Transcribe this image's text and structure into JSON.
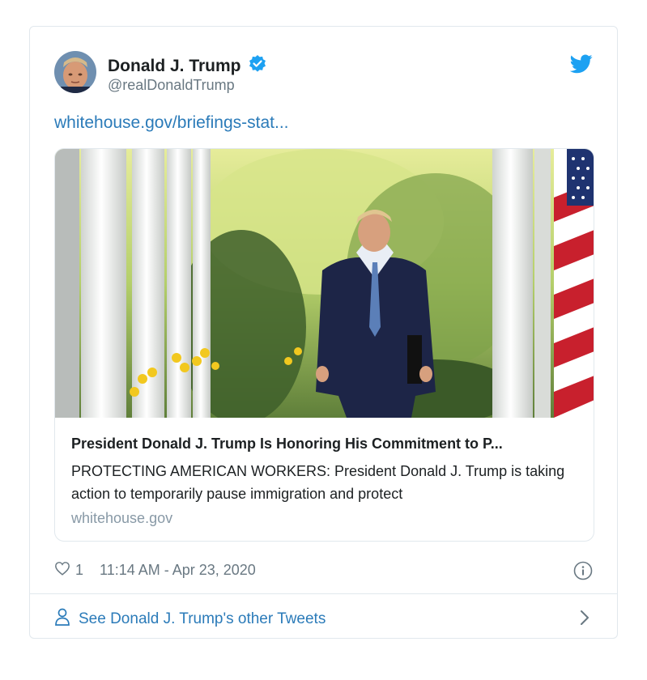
{
  "tweet": {
    "author_name": "Donald J. Trump",
    "author_handle": "@realDonaldTrump",
    "link_text": "whitehouse.gov/briefings-stat...",
    "card": {
      "title": "President Donald J. Trump Is Honoring His Commitment to P...",
      "description": "PROTECTING AMERICAN WORKERS: President Donald J. Trump is taking action to temporarily pause immigration and protect",
      "domain": "whitehouse.gov"
    },
    "like_count": "1",
    "timestamp": "11:14 AM - Apr 23, 2020",
    "other_tweets_label": "See Donald J. Trump's other Tweets"
  },
  "icons": {
    "verified": "verified-badge-icon",
    "twitter": "twitter-bird-icon",
    "heart": "heart-icon",
    "info": "info-icon",
    "person": "person-icon",
    "chevron": "chevron-right-icon"
  },
  "colors": {
    "accent": "#1da1f2",
    "link": "#2b7bb9",
    "muted": "#697882",
    "border": "#e1e8ed"
  }
}
